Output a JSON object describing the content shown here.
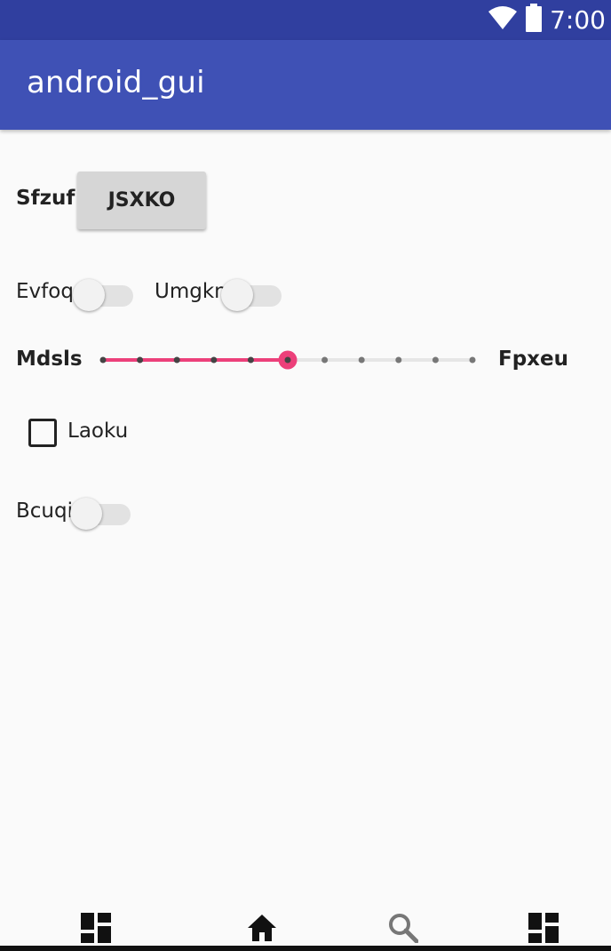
{
  "status_bar": {
    "time": "7:00",
    "icons": [
      "wifi-icon",
      "battery-icon"
    ]
  },
  "app_bar": {
    "title": "android_gui"
  },
  "form": {
    "row1": {
      "label": "Sfzuf",
      "button_label": "JSXKO"
    },
    "row2": {
      "switch1": {
        "label": "Evfoq",
        "checked": false
      },
      "switch2": {
        "label": "Umgkn",
        "checked": false
      }
    },
    "row3": {
      "left_label": "Mdsls",
      "right_label": "Fpxeu",
      "slider": {
        "min": 0,
        "max": 10,
        "value": 5,
        "accent": "#ec407a"
      }
    },
    "row4": {
      "checkbox_label": "Laoku",
      "checked": false
    },
    "row5": {
      "switch": {
        "label": "Bcuqi",
        "checked": false
      }
    }
  },
  "bottom_nav": {
    "items": [
      {
        "icon": "dashboard-icon"
      },
      {
        "icon": "home-icon"
      },
      {
        "icon": "search-icon"
      },
      {
        "icon": "dashboard-icon"
      }
    ]
  },
  "colors": {
    "status_bar": "#303f9f",
    "app_bar": "#3f51b5",
    "accent": "#ec407a",
    "background": "#fafafa"
  }
}
